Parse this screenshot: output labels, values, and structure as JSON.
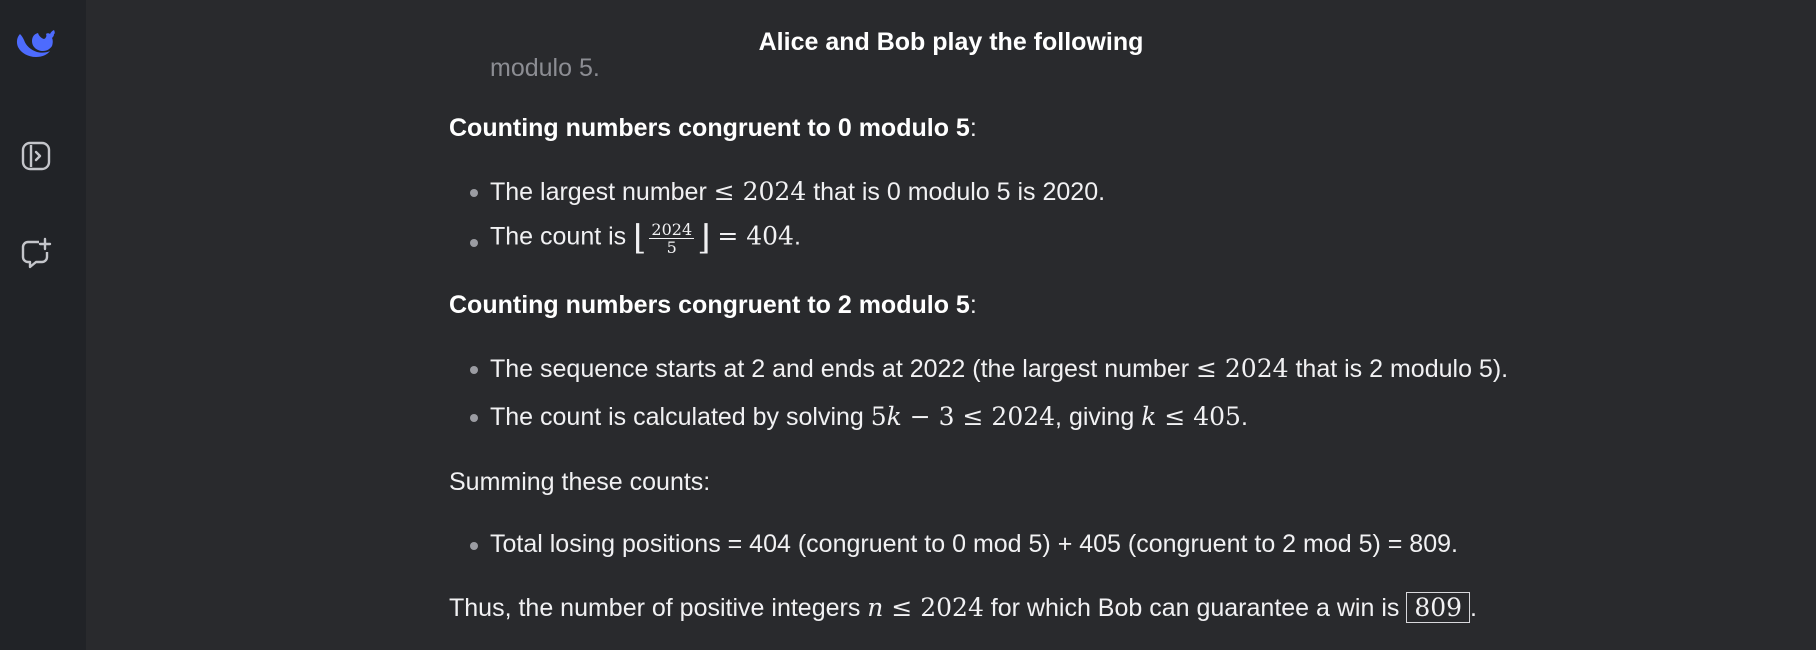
{
  "header": {
    "title": "Alice and Bob play the following"
  },
  "sidebar": {
    "logo_icon": "whale-logo-icon",
    "items": [
      {
        "icon": "sidebar-toggle-icon"
      },
      {
        "icon": "new-chat-icon"
      }
    ]
  },
  "message": {
    "clipped_top": "modulo 5.",
    "sec0": {
      "heading": "Counting numbers congruent to 0 modulo 5",
      "colon": ":"
    },
    "b1": {
      "pre": "The largest number ",
      "math": "≤ 2024",
      "post": " that is 0 modulo 5 is 2020."
    },
    "b2": {
      "pre": "The count is ",
      "floor_l": "⌊",
      "num": "2024",
      "den": "5",
      "floor_r": "⌋",
      "math": "= 404",
      "post": "."
    },
    "sec2": {
      "heading": "Counting numbers congruent to 2 modulo 5",
      "colon": ":"
    },
    "b3": {
      "pre": "The sequence starts at 2 and ends at 2022 (the largest number ",
      "math": "≤ 2024",
      "post": " that is 2 modulo 5)."
    },
    "b4": {
      "pre": "The count is calculated by solving ",
      "m1": "5",
      "k1": "k",
      "m2": " − 3 ≤ 2024",
      "mid": ", giving ",
      "k2": "k",
      "m3": " ≤ 405",
      "post": "."
    },
    "summing": "Summing these counts:",
    "b5": "Total losing positions = 404 (congruent to 0 mod 5) + 405 (congruent to 2 mod 5) = 809.",
    "final": {
      "pre": "Thus, the number of positive integers ",
      "n": "n",
      "math": " ≤ 2024",
      "mid": " for which Bob can guarantee a win is ",
      "answer": "809",
      "post": "."
    }
  },
  "colors": {
    "accent": "#4d6bfe",
    "background": "#292a2d",
    "sidebar": "#212327"
  }
}
